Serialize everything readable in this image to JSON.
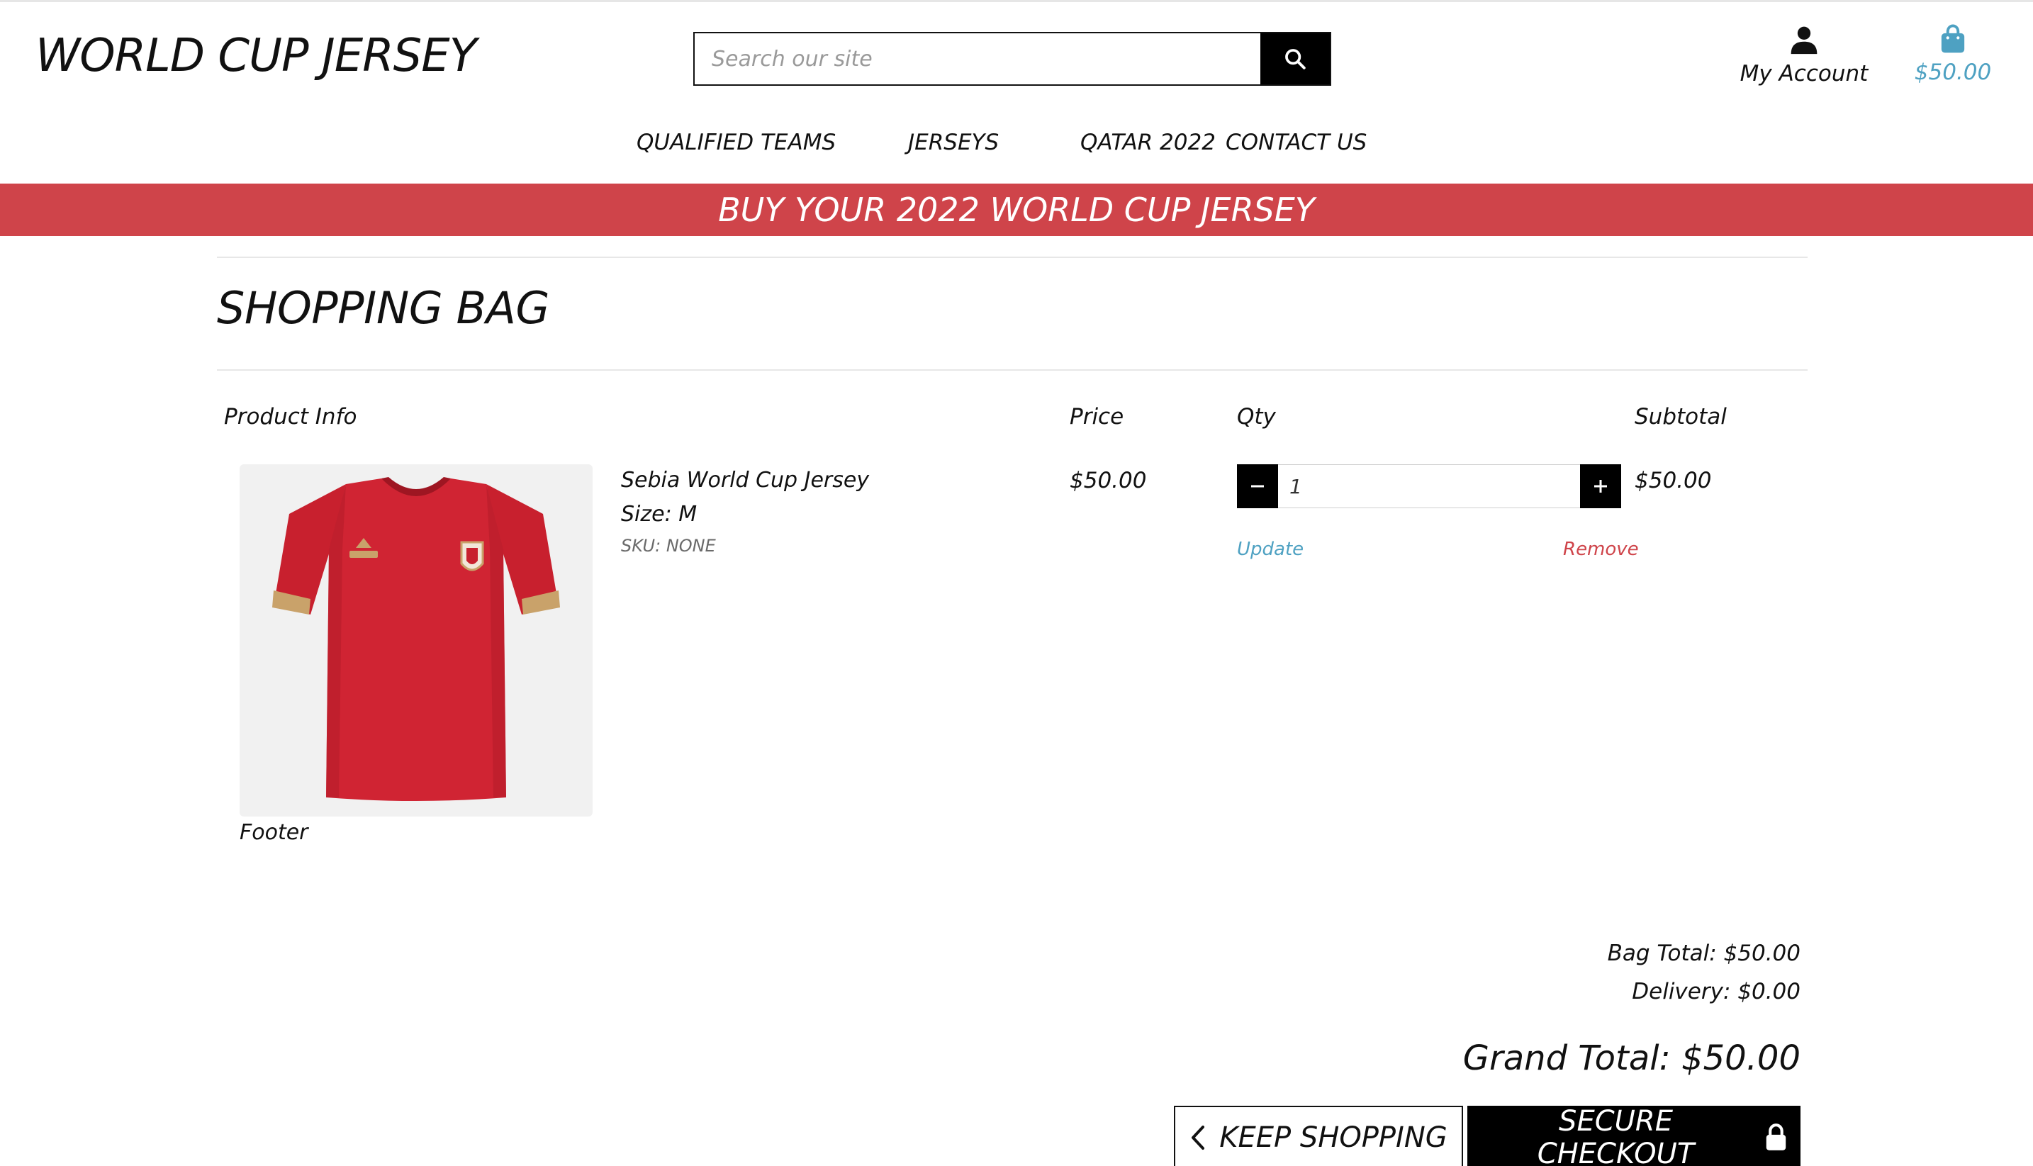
{
  "header": {
    "logo": "WORLD CUP JERSEY",
    "search_placeholder": "Search our site",
    "search_icon": "search-icon",
    "account_label": "My Account",
    "account_icon": "user-icon",
    "bag_total": "$50.00",
    "bag_icon": "shopping-bag-icon"
  },
  "nav": {
    "items": [
      "QUALIFIED TEAMS",
      "JERSEYS",
      "QATAR 2022",
      "CONTACT US"
    ]
  },
  "banner": {
    "text": "BUY YOUR 2022 WORLD CUP JERSEY"
  },
  "bag": {
    "title": "SHOPPING BAG",
    "columns": [
      "Product Info",
      "Price",
      "Qty",
      "Subtotal"
    ],
    "items": [
      {
        "name": "Sebia World Cup Jersey",
        "size": "Size: M",
        "sku": "SKU: NONE",
        "price": "$50.00",
        "qty": "1",
        "subtotal": "$50.00",
        "update_label": "Update",
        "remove_label": "Remove"
      }
    ],
    "footer_text": "Footer",
    "bag_total": "Bag Total: $50.00",
    "delivery": "Delivery: $0.00",
    "grand_total": "Grand Total: $50.00",
    "keep_shopping_label": "KEEP SHOPPING",
    "secure_checkout_label": "SECURE CHECKOUT"
  },
  "colors": {
    "banner": "#cf444a",
    "link": "#4ea1c2",
    "remove": "#cf444a",
    "jersey": "#c8202e"
  }
}
